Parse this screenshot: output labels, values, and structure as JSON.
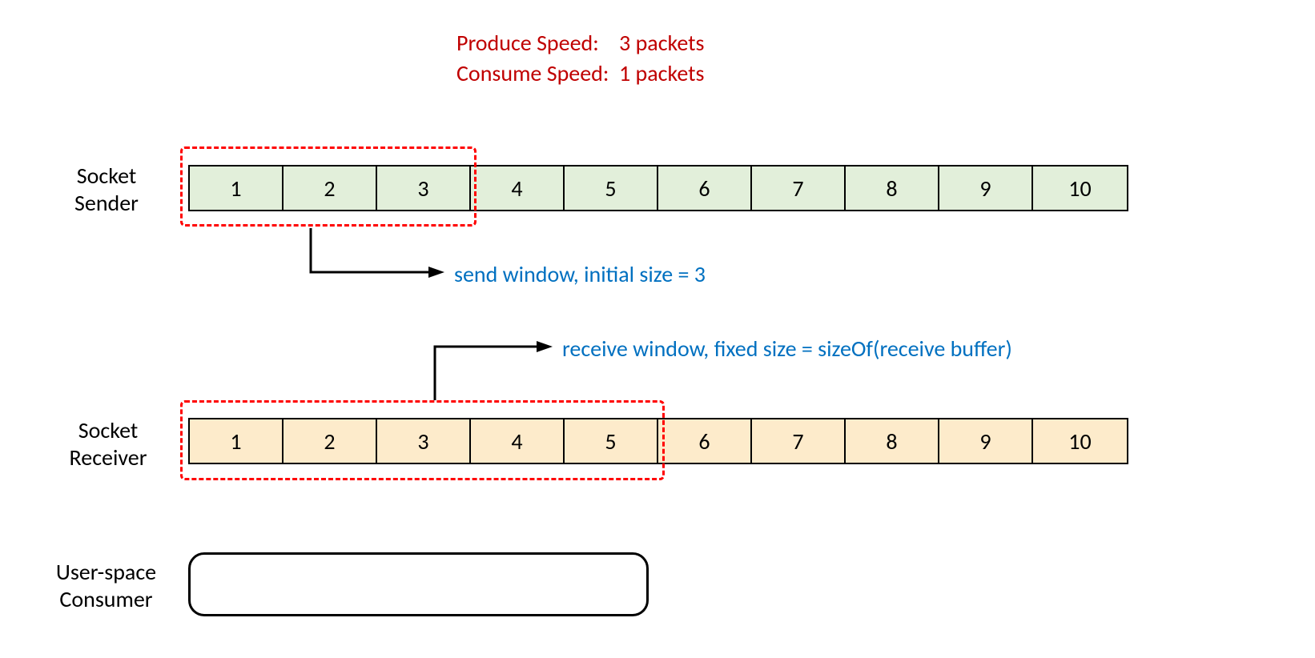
{
  "speed": {
    "produce_label": "Produce Speed:",
    "produce_value": "3 packets",
    "consume_label": "Consume Speed:",
    "consume_value": "1 packets"
  },
  "labels": {
    "sender": "Socket Sender",
    "receiver": "Socket Receiver",
    "consumer": "User-space Consumer"
  },
  "sender_cells": [
    "1",
    "2",
    "3",
    "4",
    "5",
    "6",
    "7",
    "8",
    "9",
    "10"
  ],
  "receiver_cells": [
    "1",
    "2",
    "3",
    "4",
    "5",
    "6",
    "7",
    "8",
    "9",
    "10"
  ],
  "annotations": {
    "send_window": "send window, initial size = 3",
    "receive_window": "receive window,  fixed size = sizeOf(receive buffer)"
  },
  "windows": {
    "send_size": 3,
    "receive_size": 5
  },
  "colors": {
    "speed_text": "#C00000",
    "annotation_text": "#0070C0",
    "dashed_border": "#FF0000",
    "sender_cell": "#E2EFDA",
    "receiver_cell": "#FDEBCB"
  }
}
